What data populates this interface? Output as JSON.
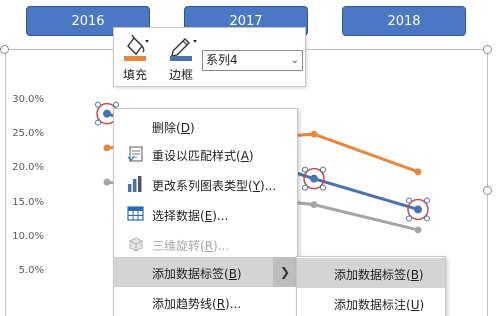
{
  "header": {
    "years": [
      "2016",
      "2017",
      "2018"
    ]
  },
  "chart_data": {
    "type": "line",
    "y_ticks": [
      "30.0%",
      "25.0%",
      "20.0%",
      "15.0%",
      "10.0%",
      "5.0%"
    ],
    "ylim": [
      0,
      0.3
    ],
    "categories": [
      "2016",
      "2017",
      "2018"
    ],
    "series": [
      {
        "color": "#e5873d",
        "values": [
          0.23,
          0.25,
          0.195
        ]
      },
      {
        "color": "#4a72b0",
        "values": [
          0.28,
          0.185,
          0.14
        ]
      },
      {
        "color": "#a5a5a5",
        "values": [
          0.18,
          0.147,
          0.11
        ]
      }
    ],
    "selected_series": 1
  },
  "toolbar": {
    "fill_label": "填充",
    "border_label": "边框",
    "series_select_value": "系列4",
    "fill_icon": "paint-bucket-icon",
    "border_icon": "pen-icon"
  },
  "context_menu": {
    "items": [
      {
        "label": "删除(D)",
        "icon": "delete-icon",
        "disabled": false
      },
      {
        "label": "重设以匹配样式(A)",
        "icon": "reset-style-icon",
        "disabled": false
      },
      {
        "label": "更改系列图表类型(Y)...",
        "icon": "chart-type-icon",
        "disabled": false
      },
      {
        "label": "选择数据(E)...",
        "icon": "select-data-icon",
        "disabled": false
      },
      {
        "label": "三维旋转(R)...",
        "icon": "3d-rotation-icon",
        "disabled": true
      },
      {
        "label": "添加数据标签(B)",
        "icon": "",
        "disabled": false,
        "has_submenu": true
      },
      {
        "label": "添加趋势线(R)...",
        "icon": "",
        "disabled": false
      }
    ]
  },
  "submenu": {
    "items": [
      {
        "label": "添加数据标签(B)"
      },
      {
        "label": "添加数据标注(U)"
      }
    ]
  },
  "colors": {
    "header_blue": "#4a78c5",
    "series_orange": "#e5873d",
    "series_blue": "#4a72b0",
    "series_gray": "#a5a5a5",
    "selection_red": "#c0504d",
    "fill_swatch": "#e5873d",
    "border_swatch": "#4a72b0"
  }
}
